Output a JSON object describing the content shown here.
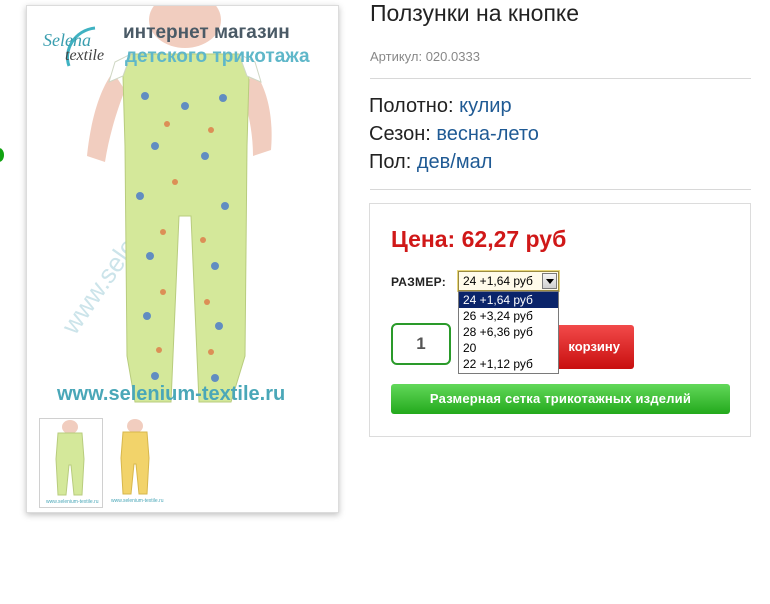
{
  "product": {
    "title": "Ползунки на кнопке",
    "article_label": "Артикул:",
    "article_value": "020.0333",
    "attributes": [
      {
        "key": "Полотно:",
        "value": "кулир"
      },
      {
        "key": "Сезон:",
        "value": "весна-лето"
      },
      {
        "key": "Пол:",
        "value": "дев/мал"
      }
    ]
  },
  "image": {
    "brand_top": "Selena",
    "brand_bottom": "textile",
    "banner_line1": "интернет магазин",
    "banner_line2": "детского трикотажа",
    "watermark": "www.selenium-textile.ru",
    "url_text": "www.selenium-textile.ru",
    "garment_color": "#d4e89a",
    "thumb2_color": "#f2d36a"
  },
  "buy": {
    "price": "Цена: 62,27 руб",
    "size_label": "РАЗМЕР:",
    "size_selected": "24 +1,64 руб",
    "size_options": [
      "24 +1,64 руб",
      "26 +3,24 руб",
      "28 +6,36 руб",
      "20",
      "22 +1,12 руб"
    ],
    "quantity": "1",
    "cart_button": "корзину",
    "size_grid_button": "Размерная сетка трикотажных изделий"
  },
  "colors": {
    "price": "#d01818",
    "link": "#1f5a94",
    "cart": "#d51a1a",
    "grid_button": "#33b52c"
  }
}
